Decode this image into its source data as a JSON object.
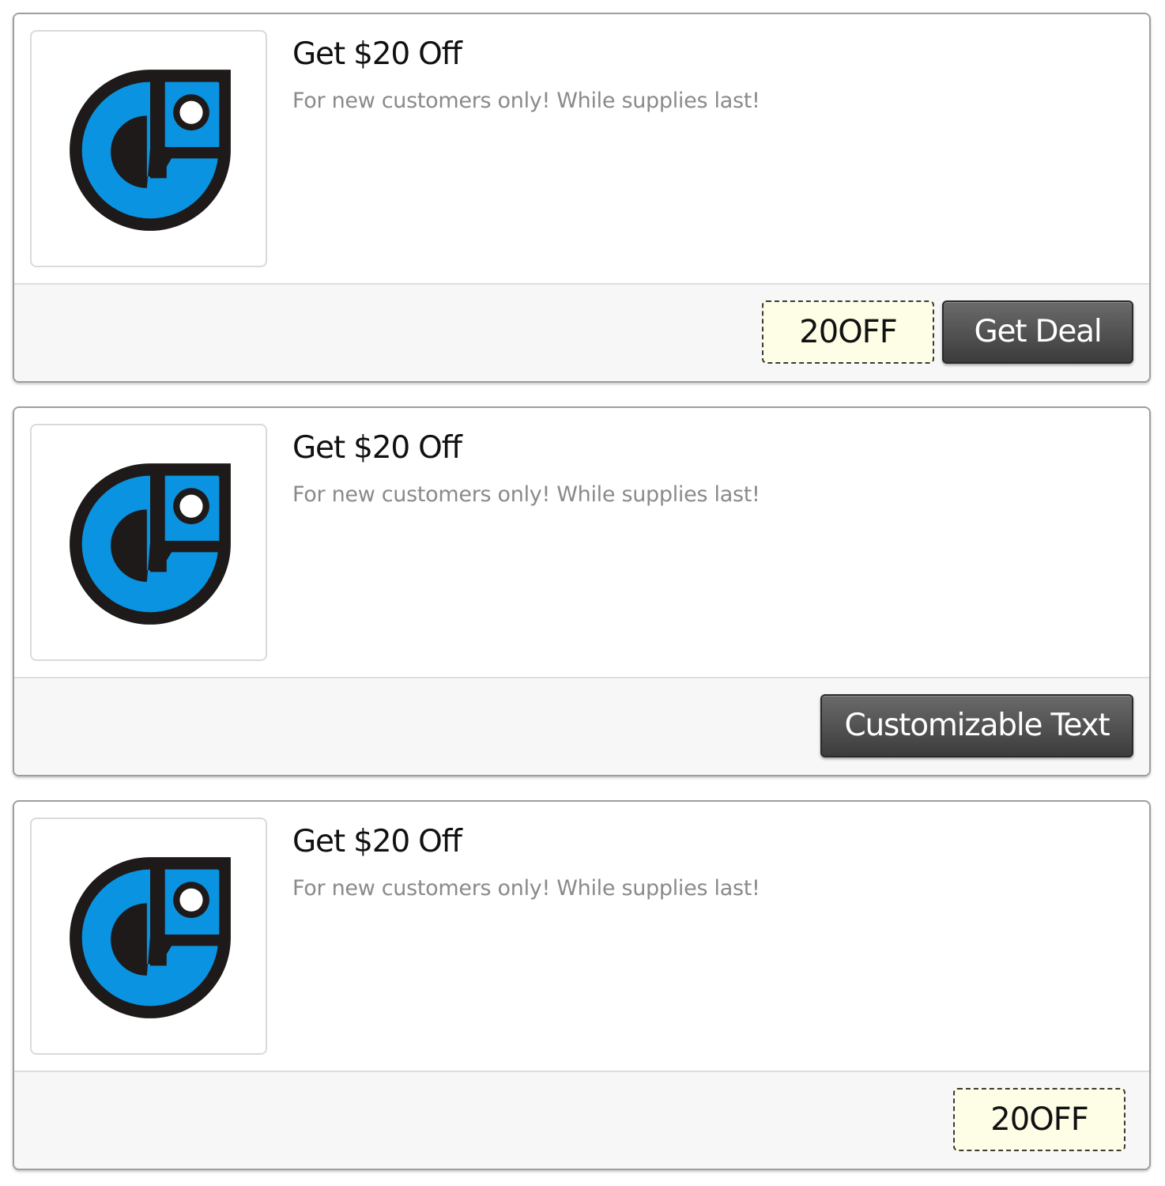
{
  "coupons": [
    {
      "title": "Get $20 Off",
      "description": "For new customers only! While supplies last!",
      "code": "20OFF",
      "button_label": "Get Deal",
      "logo_icon": "brand-logo-icon"
    },
    {
      "title": "Get $20 Off",
      "description": "For new customers only! While supplies last!",
      "button_label": "Customizable Text",
      "logo_icon": "brand-logo-icon"
    },
    {
      "title": "Get $20 Off",
      "description": "For new customers only! While supplies last!",
      "code": "20OFF",
      "logo_icon": "brand-logo-icon"
    }
  ],
  "colors": {
    "logo_blue": "#0a93e0",
    "logo_dark": "#1e1a1a",
    "code_background": "#fefde6",
    "button_background": "#4a4a4a"
  }
}
